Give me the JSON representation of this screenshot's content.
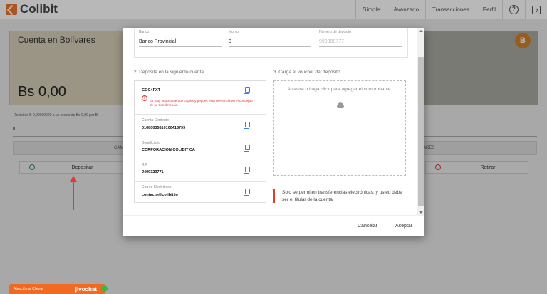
{
  "app": {
    "brand": "Colibit"
  },
  "nav": {
    "items": [
      "Simple",
      "Avanzado",
      "Transacciones",
      "Perfil"
    ],
    "help_glyph": "?"
  },
  "background": {
    "card_title": "Cuenta en Bolívares",
    "balance": "Bs 0,00",
    "coin_glyph": "B",
    "subtext": "Recibirás Ƀ 0,00000000 a un precio de Bs 0,00 por Ƀ",
    "input_value": "0",
    "tab_left": "CAM",
    "tab_right": "ARES",
    "deposit_button": "Depositar",
    "withdraw_button": "Retirar"
  },
  "chat": {
    "label": "Atención al Cliente",
    "brand": "jivochat"
  },
  "modal": {
    "fields": {
      "bank_label": "Banco",
      "bank_value": "Banco Provincial",
      "amount_label": "Monto",
      "amount_value": "0",
      "deposit_number_label": "Número de depósito",
      "deposit_number_placeholder": "999888777"
    },
    "section2_title": "2. Deposite en la siguiente cuenta",
    "section3_title": "3. Carga el voucher del depósito.",
    "reference": {
      "value": "GGC4FXT",
      "warning": "Es muy importante que copies y pegues esta referencia en el concepto de su transferencia."
    },
    "account_rows": [
      {
        "label": "Cuenta Corriente",
        "value": "01080035810100415799"
      },
      {
        "label": "Beneficiario",
        "value": "CORPORACION COLIBIT CA"
      },
      {
        "label": "RIF",
        "value": "J409329771"
      },
      {
        "label": "Correo Electrónico",
        "value": "contacto@colibit.io"
      }
    ],
    "dropzone_text": "Arrastre o haga click para agregar el comprobante.",
    "notice": "Solo se permiten transferencias electrónicas, y usted debe ser el titular de la cuenta.",
    "cancel_button": "Cancelar",
    "accept_button": "Aceptar"
  }
}
